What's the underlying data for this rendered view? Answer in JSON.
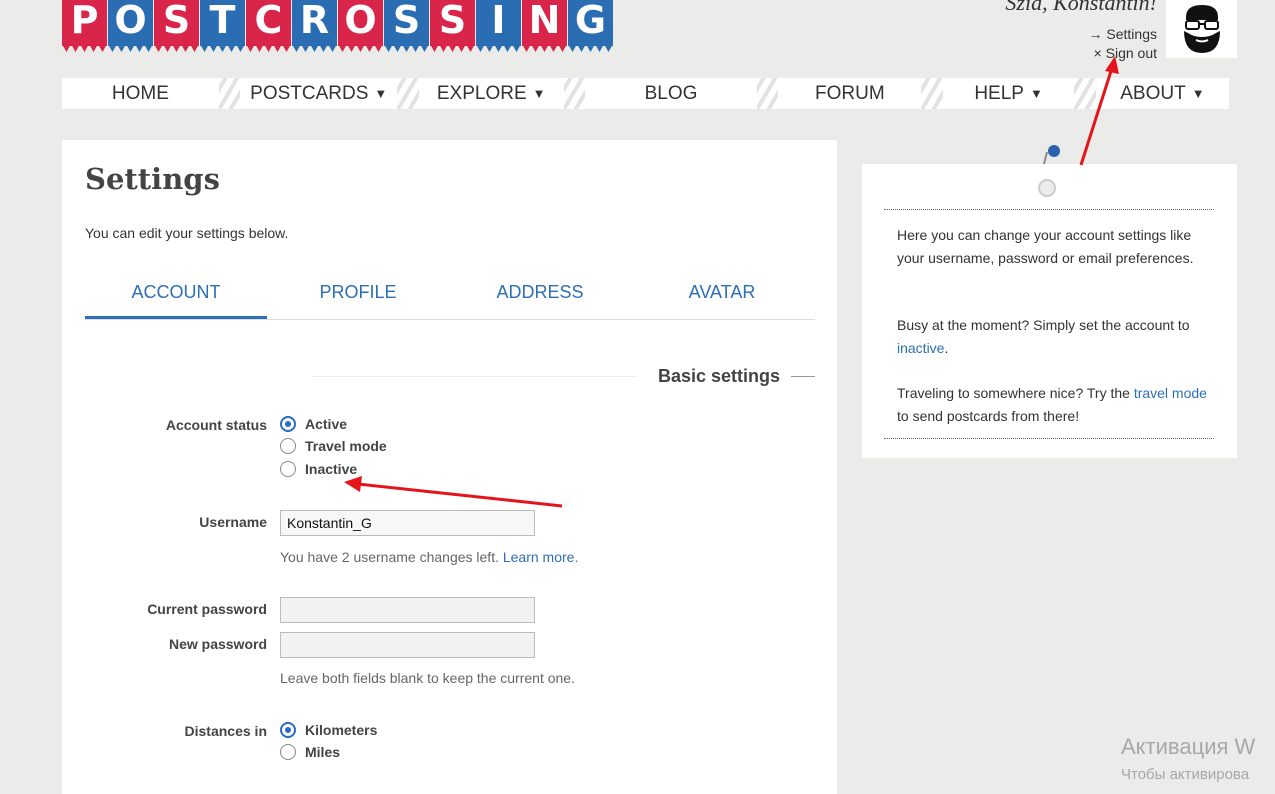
{
  "logo": {
    "letters": [
      "P",
      "O",
      "S",
      "T",
      "C",
      "R",
      "O",
      "S",
      "S",
      "I",
      "N",
      "G"
    ]
  },
  "header": {
    "greeting": "Sziá, Konstantin!",
    "settings_link": "→ Settings",
    "signout_link": "× Sign out",
    "avatar_icon": "bearded-man-glasses-avatar"
  },
  "nav": {
    "home": "HOME",
    "postcards": "POSTCARDS",
    "explore": "EXPLORE",
    "blog": "BLOG",
    "forum": "FORUM",
    "help": "HELP",
    "about": "ABOUT",
    "caret": "▼"
  },
  "main": {
    "title": "Settings",
    "subtitle": "You can edit your settings below.",
    "tabs": [
      "ACCOUNT",
      "PROFILE",
      "ADDRESS",
      "AVATAR"
    ],
    "section_title": "Basic settings",
    "account_status": {
      "label": "Account status",
      "options": [
        "Active",
        "Travel mode",
        "Inactive"
      ],
      "selected": "Active"
    },
    "username": {
      "label": "Username",
      "value": "Konstantin_G",
      "hint": "You have 2 username changes left.",
      "hint_link": "Learn more."
    },
    "current_password": {
      "label": "Current password",
      "value": ""
    },
    "new_password": {
      "label": "New password",
      "value": ""
    },
    "password_hint": "Leave both fields blank to keep the current one.",
    "distances": {
      "label": "Distances in",
      "options": [
        "Kilometers",
        "Miles"
      ],
      "selected": "Kilometers"
    }
  },
  "side": {
    "p1": "Here you can change your account settings like your username, password or email preferences.",
    "p2_pre": "Busy at the moment? Simply set the account to ",
    "p2_link": "inactive",
    "p2_post": ".",
    "p3_pre": "Traveling to somewhere nice? Try the ",
    "p3_link": "travel mode",
    "p3_post": " to send postcards from there!"
  },
  "watermark": {
    "line1": "Активация W",
    "line2": "Чтобы активирова"
  },
  "colors": {
    "accent": "#2d6fb6",
    "logo_red": "#d9254a",
    "logo_blue": "#2a6db2",
    "annotation_arrow": "#e5141b"
  }
}
